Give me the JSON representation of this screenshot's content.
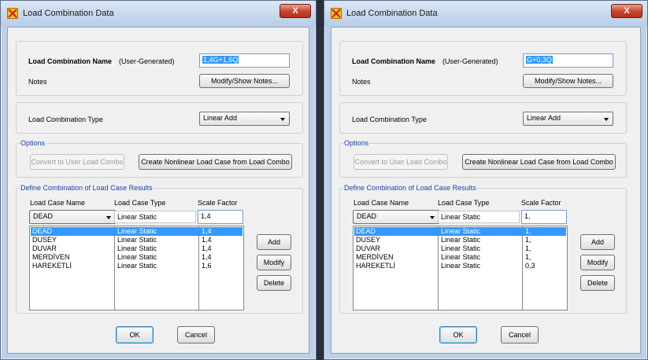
{
  "dialogs": [
    {
      "title": "Load Combination Data",
      "close_label": "X",
      "combo_name_label": "Load Combination Name",
      "user_generated": "(User-Generated)",
      "combo_name_value": "1,4G+1,6Q",
      "notes_label": "Notes",
      "notes_button": "Modify/Show Notes...",
      "combo_type_label": "Load Combination Type",
      "combo_type_value": "Linear Add",
      "options_label": "Options",
      "convert_button": "Convert to User Load Combo",
      "nonlinear_button": "Create Nonlinear Load Case from Load Combo",
      "define_label": "Define Combination of Load Case Results",
      "col_headers": [
        "Load Case Name",
        "Load Case Type",
        "Scale Factor"
      ],
      "edit_row": {
        "name": "DEAD",
        "type": "Linear Static",
        "factor": "1,4"
      },
      "rows": [
        {
          "name": "DEAD",
          "type": "Linear Static",
          "factor": "1,4"
        },
        {
          "name": "DUSEY",
          "type": "Linear Static",
          "factor": "1,4"
        },
        {
          "name": "DUVAR",
          "type": "Linear Static",
          "factor": "1,4"
        },
        {
          "name": "MERDİVEN",
          "type": "Linear Static",
          "factor": "1,4"
        },
        {
          "name": "HAREKETLİ",
          "type": "Linear Static",
          "factor": "1,6"
        }
      ],
      "add_button": "Add",
      "modify_button": "Modify",
      "delete_button": "Delete",
      "ok_button": "OK",
      "cancel_button": "Cancel"
    },
    {
      "title": "Load Combination Data",
      "close_label": "X",
      "combo_name_label": "Load Combination Name",
      "user_generated": "(User-Generated)",
      "combo_name_value": "G+0,3Q",
      "notes_label": "Notes",
      "notes_button": "Modify/Show Notes...",
      "combo_type_label": "Load Combination Type",
      "combo_type_value": "Linear Add",
      "options_label": "Options",
      "convert_button": "Convert to User Load Combo",
      "nonlinear_button": "Create Nonlinear Load Case from Load Combo",
      "define_label": "Define Combination of Load Case Results",
      "col_headers": [
        "Load Case Name",
        "Load Case Type",
        "Scale Factor"
      ],
      "edit_row": {
        "name": "DEAD",
        "type": "Linear Static",
        "factor": "1,"
      },
      "rows": [
        {
          "name": "DEAD",
          "type": "Linear Static",
          "factor": "1,"
        },
        {
          "name": "DUSEY",
          "type": "Linear Static",
          "factor": "1,"
        },
        {
          "name": "DUVAR",
          "type": "Linear Static",
          "factor": "1,"
        },
        {
          "name": "MERDİVEN",
          "type": "Linear Static",
          "factor": "1,"
        },
        {
          "name": "HAREKETLİ",
          "type": "Linear Static",
          "factor": "0,3"
        }
      ],
      "add_button": "Add",
      "modify_button": "Modify",
      "delete_button": "Delete",
      "ok_button": "OK",
      "cancel_button": "Cancel"
    }
  ]
}
